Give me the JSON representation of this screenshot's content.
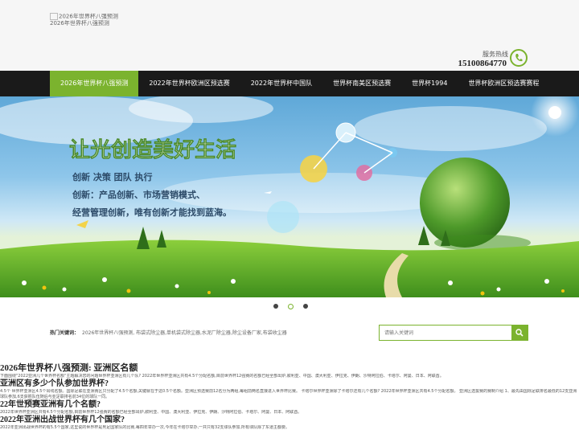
{
  "header": {
    "logo_alt": "2026年世界杯八强预测",
    "logo_text": "2026年世界杯八强预测",
    "hotline_label": "服务热线",
    "hotline_number": "15100864770"
  },
  "nav": {
    "items": [
      {
        "label": "2026年世界杯八强预测",
        "active": true
      },
      {
        "label": "2022年世界杯欧洲区预选赛",
        "active": false
      },
      {
        "label": "2022年世界杯中国队",
        "active": false
      },
      {
        "label": "世界杯南美区预选赛",
        "active": false
      },
      {
        "label": "世界杯1994",
        "active": false
      },
      {
        "label": "世界杯欧洲区预选赛赛程",
        "active": false
      }
    ]
  },
  "banner": {
    "headline": "让光创造美好生活",
    "line1": "创新  决策  团队  执行",
    "line2": "创新：产品创新、市场营销模式、",
    "line3": "经营管理创新，唯有创新才能找到蓝海。"
  },
  "slider": {
    "count": 3,
    "active_index": 2
  },
  "keywords": {
    "label": "热门关键词：",
    "text": "2026年世界杯八强预测, 布袋式除尘器,单机袋式除尘器,水泥厂除尘器,除尘设备厂家,布袋收尘器"
  },
  "search": {
    "placeholder": "请输入关键词"
  },
  "article": {
    "title": "2026年世界杯八强预测: 亚洲区名额",
    "intro": "下面围绕\"2022亚洲几个世界杯名额\"主题解决您的问题世界杯亚洲区有几个队? 2022年世界杯亚洲区共有4.5个分配名额,目前世界杯12强赛的名额已经全部出炉,叙利亚、中国、澳大利亚、伊拉克、伊朗、沙特阿拉伯、卡塔尔、阿曼、日本、阿联酋。",
    "sections": [
      {
        "heading": "亚洲区有多少个队参加世界杯?",
        "body": "4.5个 世界杯亚洲区4.5个出线名额。国际足联在亚洲赛区只分配了4.5个名额,关键就在于这0.5个名额。亚洲区预选赛前12名分为两组,每组前两名直接进入世界杯比赛。 卡塔尔世界杯亚洲除了卡塔尔还有几个名额? 2022年世界杯亚洲区共有4.5个分配名额。 亚洲区选拔赛的赛制介绍 1、最先由国际足联排名最低的12支亚洲球队参加,6支获胜队伍随后与亚足联排名前34位的球队一同。"
      },
      {
        "heading": "22年世预赛亚洲有几个名额?",
        "body": "2022年世界杯亚洲区共有4.5个分配名额,目前世界杯12强赛的名额已经全部出炉,叙利亚、中国、澳大利亚、伊拉克、伊朗、沙特阿拉伯、卡塔尔、阿曼、日本、阿联酋。"
      },
      {
        "heading": "2022年亚洲出战世界杯有几个国家?",
        "body": "2022年亚洲出战世界杯的有5.5个国家,这里说的世界杯是男足国家队的比赛,每四年举办一次,今年在卡塔尔举办,一共只有32支球队参加,所有球队除了东道主都要。"
      }
    ]
  }
}
